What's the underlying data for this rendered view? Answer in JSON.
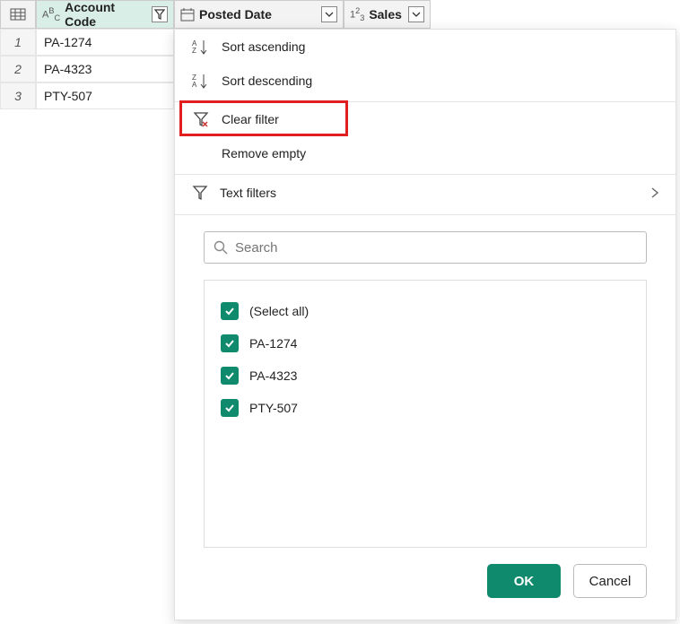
{
  "columns": {
    "account_code": "Account Code",
    "posted_date": "Posted Date",
    "sales": "Sales"
  },
  "rows": [
    {
      "num": "1",
      "account_code": "PA-1274"
    },
    {
      "num": "2",
      "account_code": "PA-4323"
    },
    {
      "num": "3",
      "account_code": "PTY-507"
    }
  ],
  "menu": {
    "sort_asc": "Sort ascending",
    "sort_desc": "Sort descending",
    "clear_filter": "Clear filter",
    "remove_empty": "Remove empty",
    "text_filters": "Text filters"
  },
  "search": {
    "placeholder": "Search"
  },
  "filter_items": [
    {
      "label": "(Select all)",
      "checked": true
    },
    {
      "label": "PA-1274",
      "checked": true
    },
    {
      "label": "PA-4323",
      "checked": true
    },
    {
      "label": "PTY-507",
      "checked": true
    }
  ],
  "buttons": {
    "ok": "OK",
    "cancel": "Cancel"
  }
}
